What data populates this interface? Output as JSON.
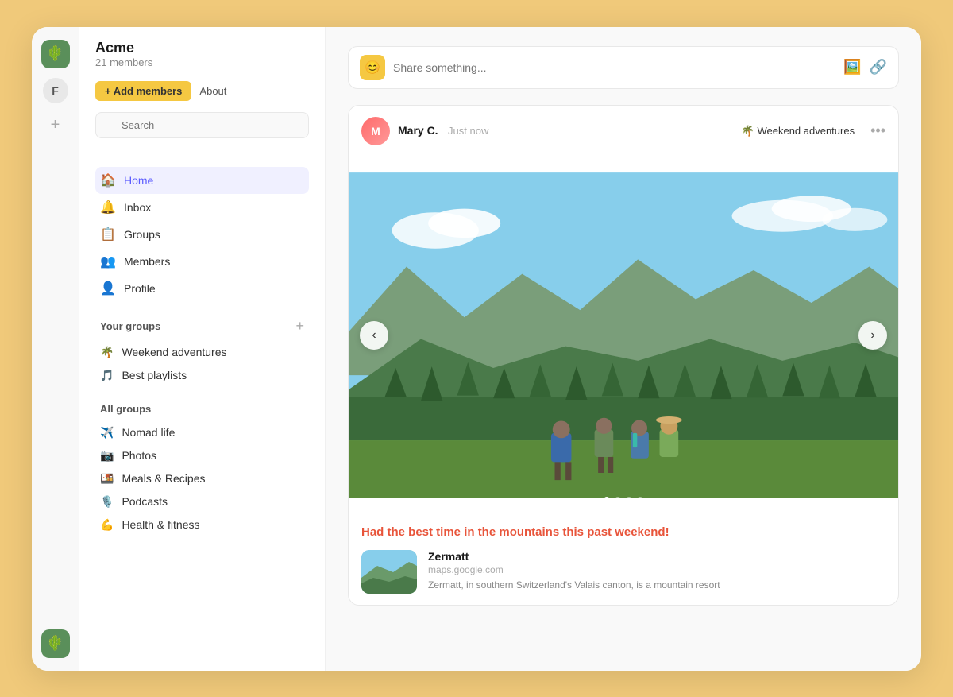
{
  "app": {
    "logo_emoji": "🌵",
    "org_name": "Acme",
    "org_members": "21 members",
    "add_members_label": "+ Add members",
    "about_label": "About",
    "search_placeholder": "Search"
  },
  "sidebar_icon_letter": "F",
  "nav_items": [
    {
      "id": "home",
      "icon": "🏠",
      "label": "Home",
      "active": true
    },
    {
      "id": "inbox",
      "icon": "🔔",
      "label": "Inbox",
      "active": false
    },
    {
      "id": "groups",
      "icon": "📋",
      "label": "Groups",
      "active": false
    },
    {
      "id": "members",
      "icon": "👥",
      "label": "Members",
      "active": false
    },
    {
      "id": "profile",
      "icon": "👤",
      "label": "Profile",
      "active": false
    }
  ],
  "your_groups_label": "Your groups",
  "your_groups": [
    {
      "icon": "🌴",
      "label": "Weekend adventures"
    },
    {
      "icon": "🎵",
      "label": "Best playlists"
    }
  ],
  "all_groups_label": "All groups",
  "all_groups": [
    {
      "icon": "✈️",
      "label": "Nomad life"
    },
    {
      "icon": "📷",
      "label": "Photos"
    },
    {
      "icon": "🍱",
      "label": "Meals & Recipes"
    },
    {
      "icon": "🎙️",
      "label": "Podcasts"
    },
    {
      "icon": "💪",
      "label": "Health & fitness"
    }
  ],
  "share_placeholder": "Share something...",
  "post": {
    "author": "Mary C.",
    "time": "Just now",
    "group": "🌴 Weekend adventures",
    "caption": "Had the best time in the mountains this past weekend!",
    "carousel_dots": 4,
    "active_dot": 0,
    "link_title": "Zermatt",
    "link_url": "maps.google.com",
    "link_desc": "Zermatt, in southern Switzerland's Valais canton, is a mountain resort"
  }
}
